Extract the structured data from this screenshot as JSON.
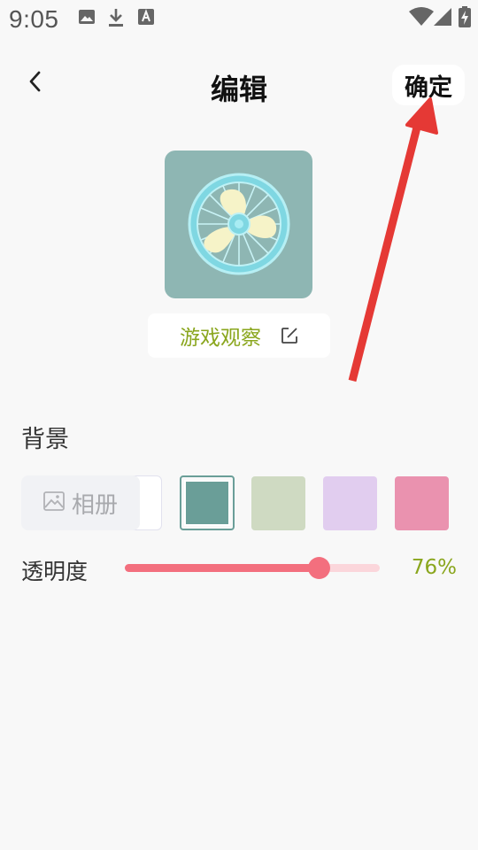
{
  "status_bar": {
    "time": "9:05",
    "icons": [
      "image-icon",
      "download-icon",
      "text-a-icon",
      "wifi-icon",
      "signal-icon",
      "battery-charging-icon"
    ]
  },
  "header": {
    "title": "编辑",
    "back_icon": "chevron-left-icon",
    "confirm_label": "确定"
  },
  "profile": {
    "avatar_icon": "fan-icon",
    "avatar_bg": "#8eb6b3",
    "name": "游戏观察",
    "edit_icon": "edit-icon"
  },
  "annotation": {
    "arrow_color": "#e53935",
    "arrow_icon": "arrow-up-right-icon"
  },
  "background_section": {
    "label": "背景",
    "album_label": "相册",
    "album_icon": "image-icon",
    "swatches": [
      {
        "name": "white",
        "color": "#ffffff",
        "selected": false
      },
      {
        "name": "teal",
        "color": "#6a9e98",
        "selected": true
      },
      {
        "name": "sage",
        "color": "#cfdac2",
        "selected": false
      },
      {
        "name": "lavender",
        "color": "#e1cdef",
        "selected": false
      },
      {
        "name": "pink",
        "color": "#ea92af",
        "selected": false
      }
    ]
  },
  "opacity": {
    "label": "透明度",
    "value": 0.76,
    "value_text": "76%",
    "fill_color": "#f36f7e",
    "track_color": "#fbd6db",
    "value_color": "#8aa61d"
  }
}
